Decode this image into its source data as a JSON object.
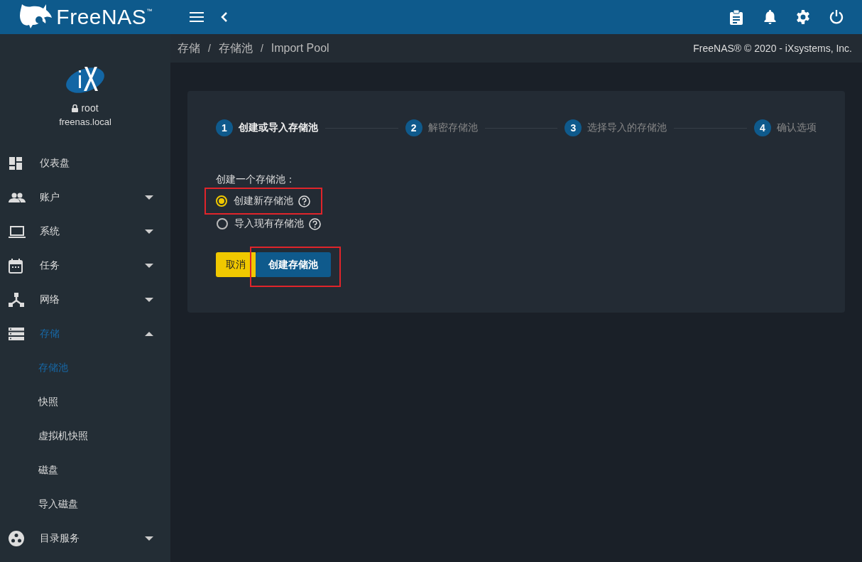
{
  "topbar": {
    "logo": "FreeNAS",
    "trademark": "™"
  },
  "sidebar": {
    "user": "root",
    "host": "freenas.local",
    "items": [
      {
        "label": "仪表盘",
        "kind": "dashboard",
        "selected": false
      },
      {
        "label": "账户",
        "kind": "people",
        "selected": false,
        "expanded": false
      },
      {
        "label": "系统",
        "kind": "laptop",
        "selected": false,
        "expanded": false
      },
      {
        "label": "任务",
        "kind": "calendar",
        "selected": false,
        "expanded": false
      },
      {
        "label": "网络",
        "kind": "network",
        "selected": false,
        "expanded": false
      },
      {
        "label": "存储",
        "kind": "storage",
        "selected": true,
        "expanded": true,
        "children": [
          {
            "label": "存储池",
            "selected": true
          },
          {
            "label": "快照",
            "selected": false
          },
          {
            "label": "虚拟机快照",
            "selected": false
          },
          {
            "label": "磁盘",
            "selected": false
          },
          {
            "label": "导入磁盘",
            "selected": false
          }
        ]
      },
      {
        "label": "目录服务",
        "kind": "directory",
        "selected": false,
        "expanded": false
      }
    ]
  },
  "breadcrumb": [
    "存储",
    "/",
    "存储池",
    "/",
    "Import Pool"
  ],
  "copyright": "FreeNAS® © 2020 - iXsystems, Inc.",
  "steps": [
    {
      "number": "1",
      "label": "创建或导入存储池",
      "selected": true
    },
    {
      "number": "2",
      "label": "解密存储池",
      "selected": false
    },
    {
      "number": "3",
      "label": "选择导入的存储池",
      "selected": false
    },
    {
      "number": "4",
      "label": "确认选项",
      "selected": false
    }
  ],
  "form": {
    "legend": "创建一个存储池：",
    "options": [
      {
        "label": "创建新存储池",
        "selected": true,
        "highlighted": true
      },
      {
        "label": "导入现有存储池",
        "selected": false,
        "highlighted": false
      }
    ],
    "buttons": [
      {
        "label": "取消",
        "kind": "cancel",
        "highlighted": false
      },
      {
        "label": "创建存储池",
        "kind": "primary",
        "highlighted": true
      }
    ]
  }
}
